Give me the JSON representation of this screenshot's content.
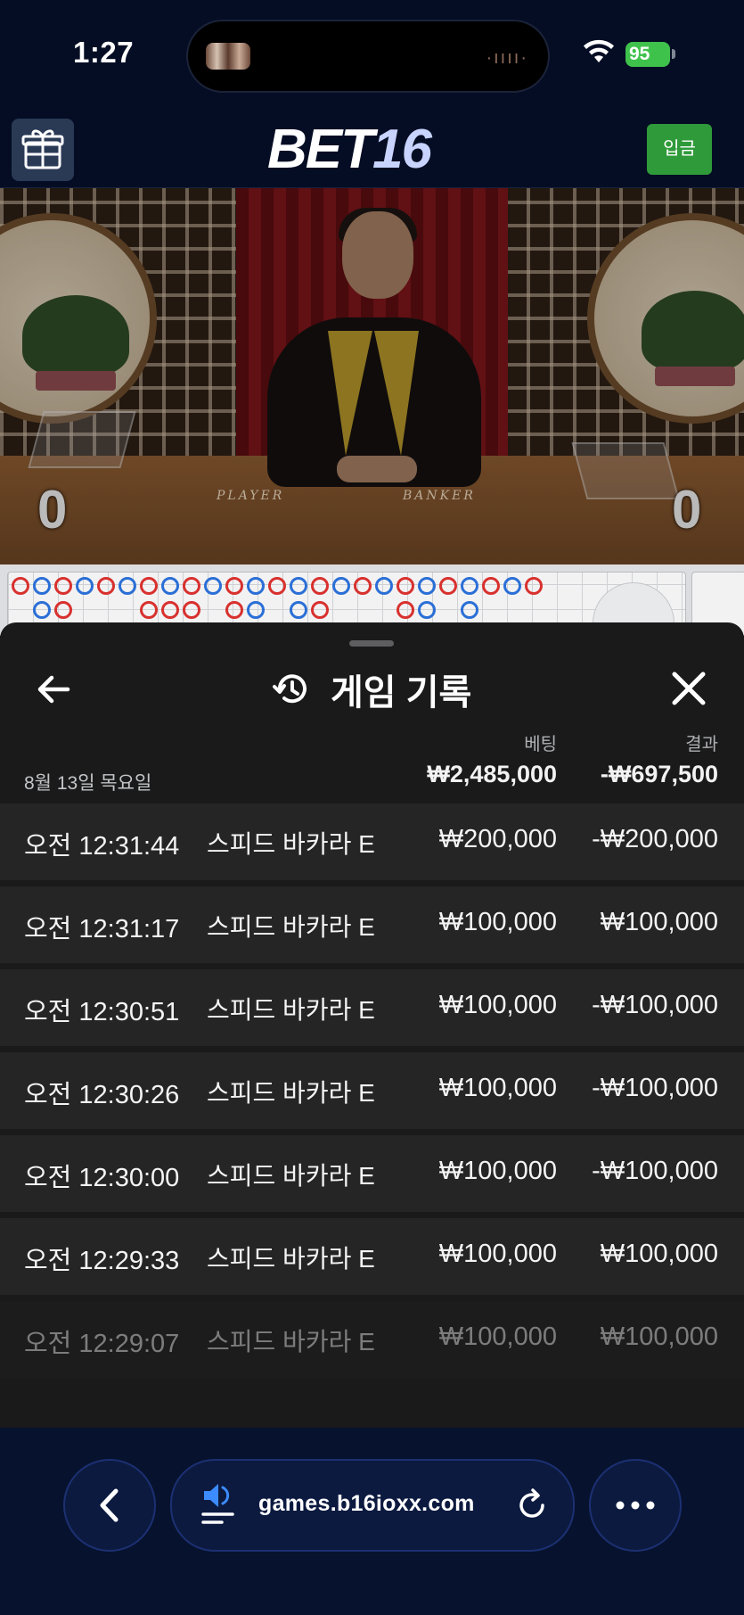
{
  "status_bar": {
    "time": "1:27",
    "battery": "95"
  },
  "header": {
    "logo_part1": "BET",
    "logo_part2": "16",
    "deposit_label": "입금"
  },
  "video": {
    "player_label": "PLAYER",
    "banker_label": "BANKER",
    "player_score": "0",
    "banker_score": "0"
  },
  "history": {
    "title": "게임 기록",
    "col_bet": "베팅",
    "col_result": "결과",
    "day": "8월 13일 목요일",
    "total_bet": "₩2,485,000",
    "total_result": "-₩697,500",
    "rows": [
      {
        "time": "오전 12:31:44",
        "game": "스피드 바카라 E",
        "bet": "₩200,000",
        "result": "-₩200,000"
      },
      {
        "time": "오전 12:31:17",
        "game": "스피드 바카라 E",
        "bet": "₩100,000",
        "result": "₩100,000"
      },
      {
        "time": "오전 12:30:51",
        "game": "스피드 바카라 E",
        "bet": "₩100,000",
        "result": "-₩100,000"
      },
      {
        "time": "오전 12:30:26",
        "game": "스피드 바카라 E",
        "bet": "₩100,000",
        "result": "-₩100,000"
      },
      {
        "time": "오전 12:30:00",
        "game": "스피드 바카라 E",
        "bet": "₩100,000",
        "result": "-₩100,000"
      },
      {
        "time": "오전 12:29:33",
        "game": "스피드 바카라 E",
        "bet": "₩100,000",
        "result": "₩100,000"
      },
      {
        "time": "오전 12:29:07",
        "game": "스피드 바카라 E",
        "bet": "₩100,000",
        "result": "₩100,000"
      }
    ]
  },
  "browser": {
    "url": "games.b16ioxx.com"
  },
  "colors": {
    "background": "#050d24",
    "deposit_green": "#2f9a39",
    "sheet": "#1a1a1b",
    "row": "#252526",
    "banker_red": "#d8312e",
    "player_blue": "#2b6fd6"
  }
}
